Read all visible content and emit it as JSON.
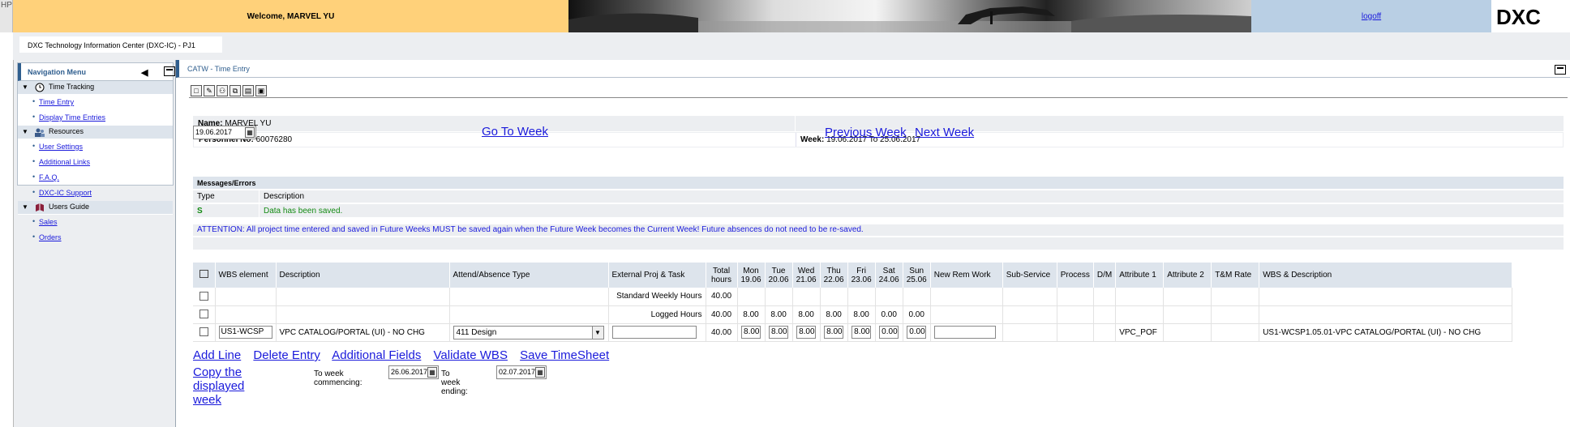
{
  "banner": {
    "hp_label": "HP",
    "welcome": "Welcome, MARVEL YU",
    "logoff": "logoff",
    "logo": "DXC"
  },
  "system": {
    "name": "DXC Technology Information Center (DXC-IC) - PJ1"
  },
  "nav": {
    "title": "Navigation Menu",
    "groups": [
      {
        "label": "Time Tracking",
        "icon": "clock-icon",
        "items": [
          "Time Entry",
          "Display Time Entries"
        ]
      },
      {
        "label": "Resources",
        "icon": "people-icon",
        "items": [
          "User Settings",
          "Additional Links",
          "F.A.Q.",
          "DXC-IC Support"
        ]
      },
      {
        "label": "Users Guide",
        "icon": "book-icon",
        "items": [
          "Sales",
          "Orders"
        ]
      }
    ]
  },
  "main": {
    "title": "CATW - Time Entry",
    "name_label": "Name:",
    "name_value": "MARVEL YU",
    "pers_label": "Personnel No:",
    "pers_value": "60076280",
    "week_label": "Week:",
    "week_value": "19.06.2017 To 25.06.2017",
    "date_field": "19.06.2017",
    "go_to_week": "Go To Week",
    "previous_week": "Previous Week",
    "next_week": "Next Week",
    "messages_title": "Messages/Errors",
    "msg_col_type": "Type",
    "msg_col_desc": "Description",
    "msg_type": "S",
    "msg_text": "Data has been saved.",
    "attention": "ATTENTION: All project time entered and saved in Future Weeks MUST be saved again when the Future Week becomes the Current Week! Future absences do not need to be re-saved."
  },
  "table": {
    "headers": {
      "wbs": "WBS element",
      "desc": "Description",
      "attend": "Attend/Absence Type",
      "ext": "External Proj & Task",
      "total1": "Total",
      "total2": "hours",
      "mon1": "Mon",
      "mon2": "19.06",
      "tue1": "Tue",
      "tue2": "20.06",
      "wed1": "Wed",
      "wed2": "21.06",
      "thu1": "Thu",
      "thu2": "22.06",
      "fri1": "Fri",
      "fri2": "23.06",
      "sat1": "Sat",
      "sat2": "24.06",
      "sun1": "Sun",
      "sun2": "25.06",
      "newrem": "New Rem Work",
      "subservice": "Sub-Service",
      "process": "Process",
      "dm": "D/M",
      "attr1": "Attribute 1",
      "attr2": "Attribute 2",
      "tmrate": "T&M Rate",
      "wbsdesc": "WBS & Description"
    },
    "standard": {
      "label": "Standard Weekly Hours",
      "total": "40.00"
    },
    "logged": {
      "label": "Logged Hours",
      "total": "40.00",
      "mon": "8.00",
      "tue": "8.00",
      "wed": "8.00",
      "thu": "8.00",
      "fri": "8.00",
      "sat": "0.00",
      "sun": "0.00"
    },
    "entry": {
      "wbs": "US1-WCSP",
      "desc": "VPC CATALOG/PORTAL (UI) - NO CHG",
      "attend": "411 Design",
      "ext": "",
      "total": "40.00",
      "mon": "8.00",
      "tue": "8.00",
      "wed": "8.00",
      "thu": "8.00",
      "fri": "8.00",
      "sat": "0.00",
      "sun": "0.00",
      "newrem": "",
      "attr1": "VPC_POF",
      "wbsdesc": "US1-WCSP1.05.01-VPC CATALOG/PORTAL (UI) - NO CHG"
    }
  },
  "actions": {
    "add_line": "Add Line",
    "delete_entry": "Delete Entry",
    "additional_fields": "Additional Fields",
    "validate_wbs": "Validate WBS",
    "save_timesheet": "Save TimeSheet",
    "copy_week": "Copy the displayed week",
    "to_week_commencing": "To week commencing:",
    "commencing_date": "26.06.2017",
    "to_week_ending": "To week ending:",
    "ending_date": "02.07.2017"
  }
}
